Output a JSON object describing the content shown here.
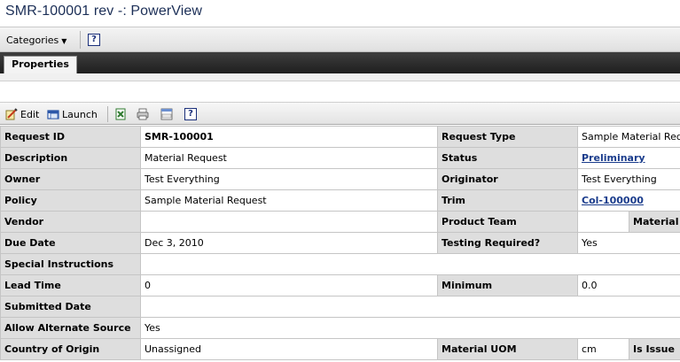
{
  "window": {
    "title": "SMR-100001 rev -: PowerView"
  },
  "menubar": {
    "categories_label": "Categories",
    "help_icon": "help-icon"
  },
  "tabs": [
    {
      "label": "Properties"
    }
  ],
  "toolbar": {
    "edit_label": "Edit",
    "launch_label": "Launch",
    "icons": [
      "edit-icon",
      "launch-icon",
      "export-excel-icon",
      "print-icon",
      "url-icon",
      "help-icon"
    ]
  },
  "colors": {
    "title": "#1c2f57",
    "tabbar": "#2a2a2a",
    "label_bg": "#dedede",
    "link": "#1a3c8c"
  },
  "props": {
    "request_id": {
      "label": "Request ID",
      "value": "SMR-100001"
    },
    "request_type": {
      "label": "Request Type",
      "value": "Sample Material Request"
    },
    "description": {
      "label": "Description",
      "value": "Material Request"
    },
    "status": {
      "label": "Status",
      "value": "Preliminary"
    },
    "owner": {
      "label": "Owner",
      "value": "Test Everything"
    },
    "originator": {
      "label": "Originator",
      "value": "Test Everything"
    },
    "policy": {
      "label": "Policy",
      "value": "Sample Material Request"
    },
    "trim": {
      "label": "Trim",
      "value": "Col-100000"
    },
    "vendor": {
      "label": "Vendor",
      "value": ""
    },
    "product_team": {
      "label": "Product Team",
      "value": "",
      "extra": "Material"
    },
    "due_date": {
      "label": "Due Date",
      "value": "Dec 3, 2010"
    },
    "testing_required": {
      "label": "Testing Required?",
      "value": "Yes"
    },
    "special_instructions": {
      "label": "Special Instructions",
      "value": ""
    },
    "lead_time": {
      "label": "Lead Time",
      "value": "0"
    },
    "minimum": {
      "label": "Minimum",
      "value": "0.0"
    },
    "submitted_date": {
      "label": "Submitted Date",
      "value": ""
    },
    "allow_alternate_source": {
      "label": "Allow Alternate Source",
      "value": "Yes"
    },
    "country_of_origin": {
      "label": "Country of Origin",
      "value": "Unassigned"
    },
    "material_uom": {
      "label": "Material UOM",
      "value": "cm",
      "extra": "Is Issue"
    }
  }
}
